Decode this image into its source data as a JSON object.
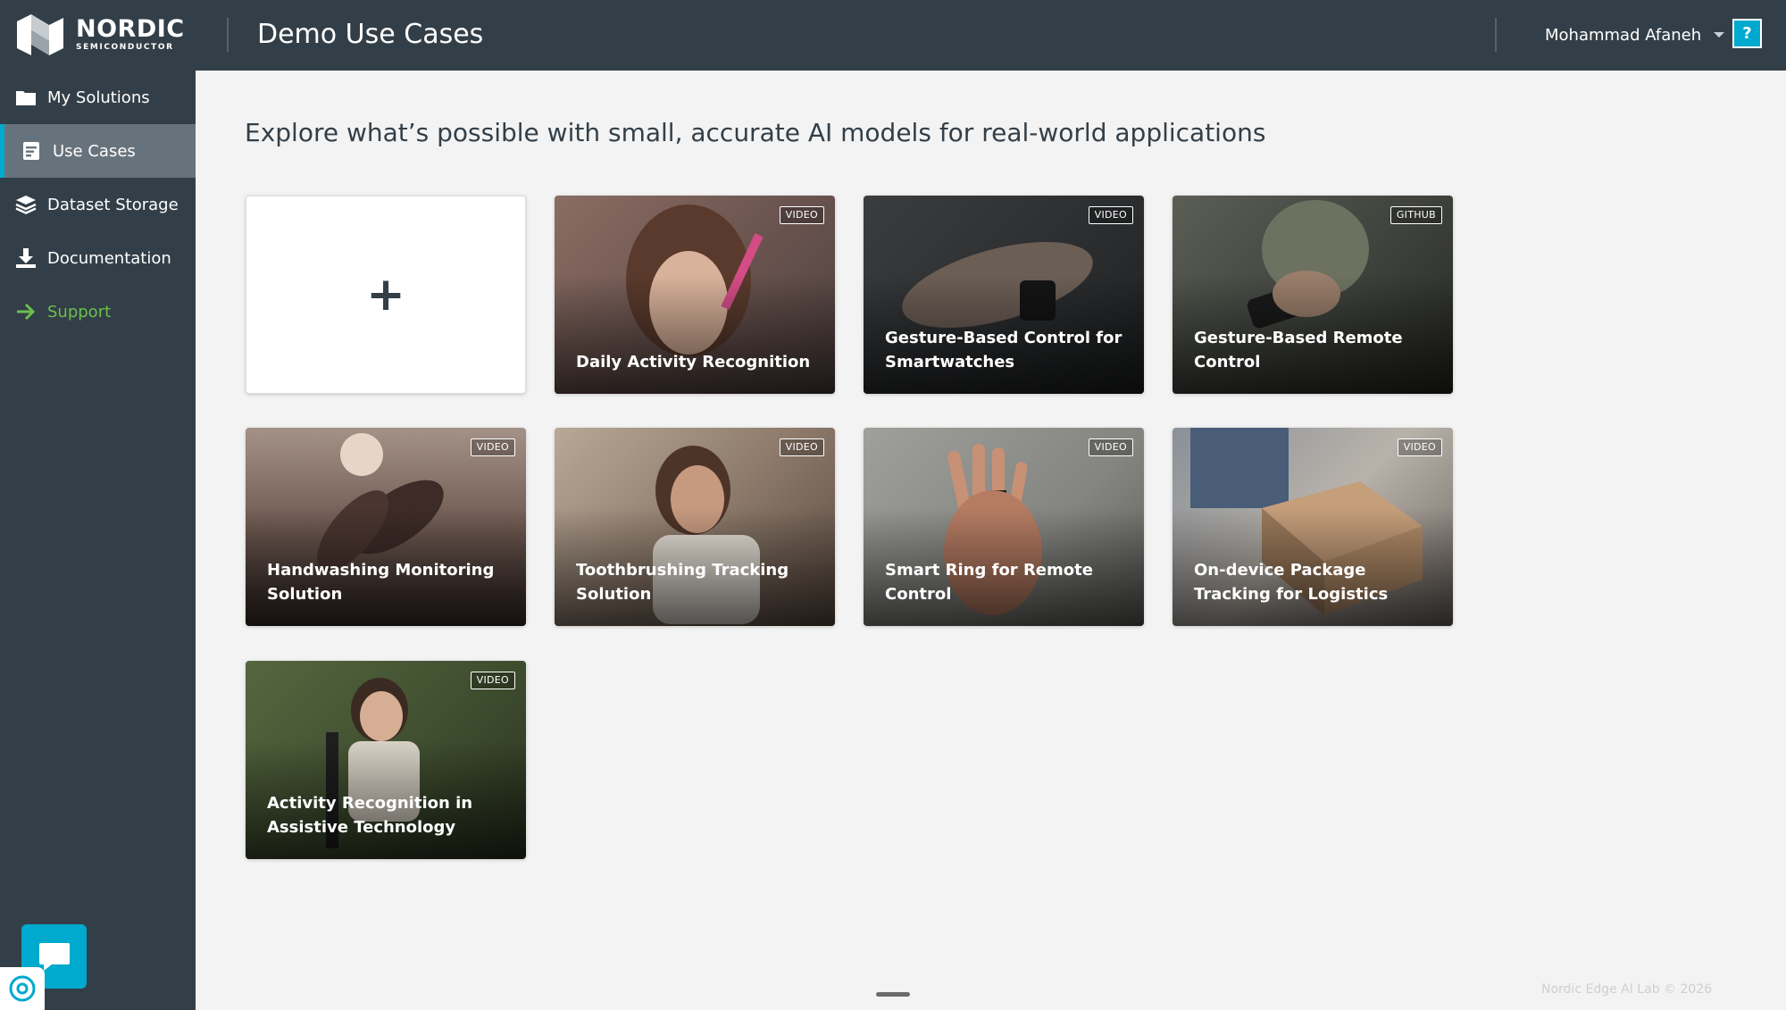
{
  "header": {
    "logo": {
      "word": "NORDIC",
      "sub": "SEMICONDUCTOR"
    },
    "title": "Demo Use Cases",
    "user_name": "Mohammad Afaneh",
    "help_label": "?"
  },
  "sidebar": {
    "items": [
      {
        "label": "My Solutions",
        "icon": "folder-icon"
      },
      {
        "label": "Use Cases",
        "icon": "document-list-icon",
        "active": true
      },
      {
        "label": "Dataset Storage",
        "icon": "layers-icon"
      },
      {
        "label": "Documentation",
        "icon": "download-icon"
      },
      {
        "label": "Support",
        "icon": "arrow-right-icon"
      }
    ]
  },
  "main": {
    "headline": "Explore what’s possible with small, accurate AI models for real-world applications",
    "add_card_label": "+",
    "cards": [
      {
        "title": "Daily Activity Recognition",
        "tag": "VIDEO"
      },
      {
        "title": "Gesture-Based Control for Smartwatches",
        "tag": "VIDEO"
      },
      {
        "title": "Gesture-Based Remote Control",
        "tag": "GITHUB"
      },
      {
        "title": "Handwashing Monitoring Solution",
        "tag": "VIDEO"
      },
      {
        "title": "Toothbrushing Tracking Solution",
        "tag": "VIDEO"
      },
      {
        "title": "Smart Ring for Remote Control",
        "tag": "VIDEO"
      },
      {
        "title": "On-device Package Tracking for Logistics",
        "tag": "VIDEO"
      },
      {
        "title": "Activity Recognition in Assistive Technology",
        "tag": "VIDEO"
      }
    ]
  },
  "footer": {
    "text": "Nordic Edge AI Lab © 2026"
  },
  "colors": {
    "nav_bg": "#333f48",
    "accent": "#00a9ce",
    "support_green": "#6cbf4b",
    "active_bg": "#67737c"
  }
}
